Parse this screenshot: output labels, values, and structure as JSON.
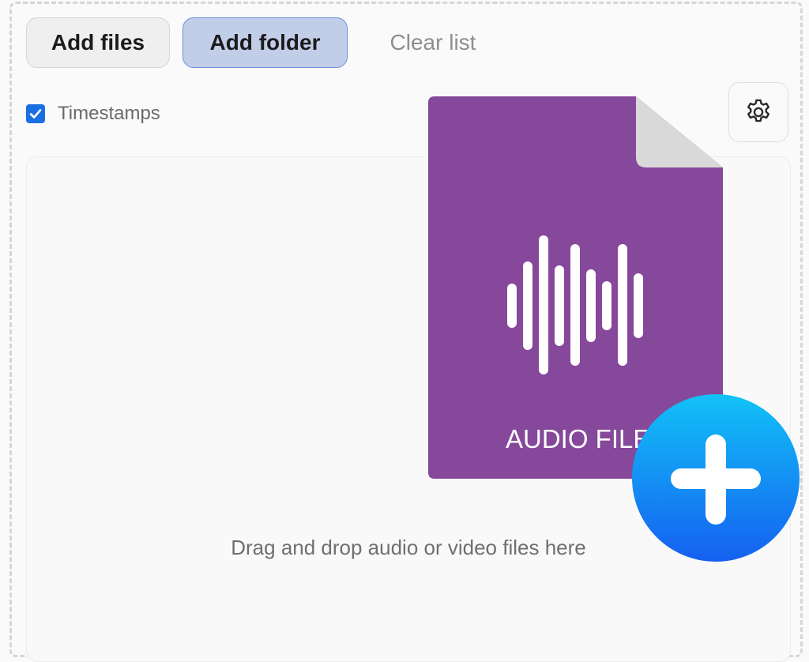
{
  "toolbar": {
    "add_files_label": "Add files",
    "add_folder_label": "Add folder",
    "clear_list_label": "Clear list"
  },
  "options": {
    "timestamps_label": "Timestamps",
    "timestamps_checked": true,
    "settings_icon": "gear-icon"
  },
  "dropzone": {
    "hint_text": "Drag and drop audio or video files here"
  },
  "graphic": {
    "file_label": "AUDIO FILE",
    "file_color": "#86489b",
    "add_icon": "plus-icon",
    "add_color_top": "#12c2f7",
    "add_color_bottom": "#1560f0"
  },
  "colors": {
    "accent": "#1a6fe0",
    "folder_button_bg": "#c2cde8",
    "folder_button_border": "#6e8fd6"
  }
}
